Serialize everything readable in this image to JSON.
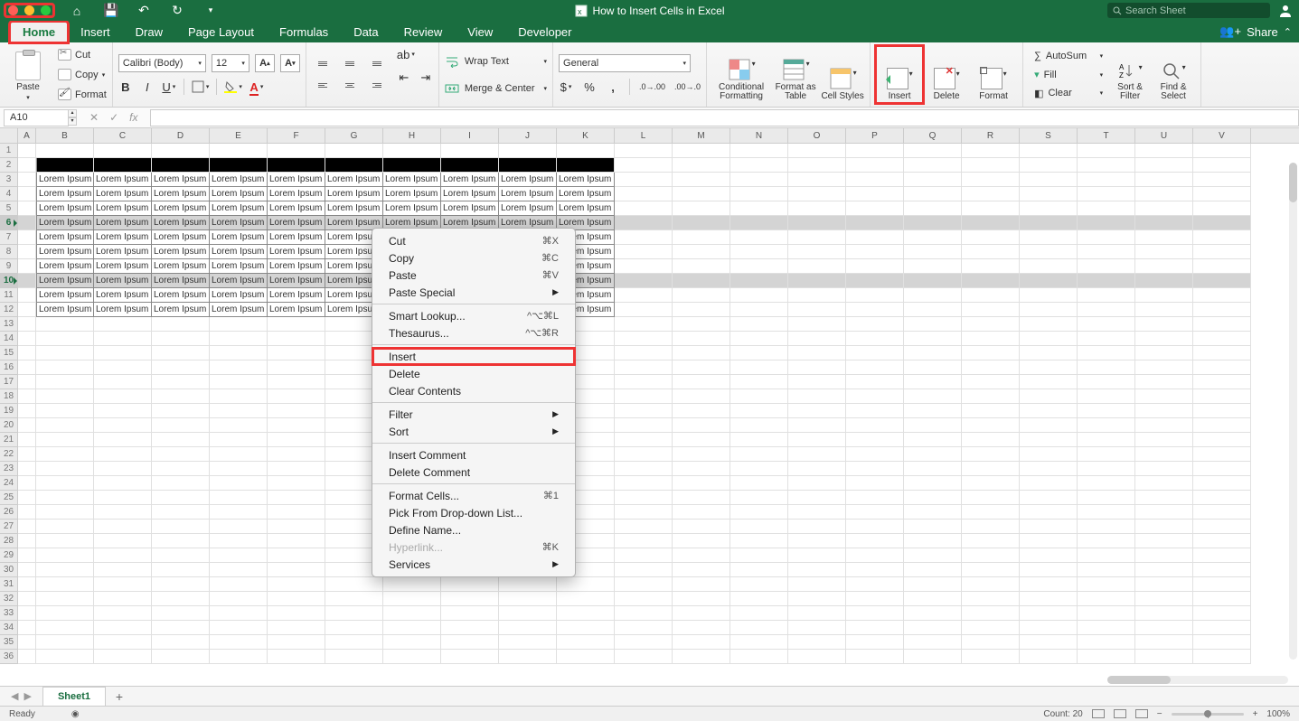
{
  "title": "How to Insert Cells in Excel",
  "search_placeholder": "Search Sheet",
  "share_label": "Share",
  "menu_tabs": [
    "Home",
    "Insert",
    "Draw",
    "Page Layout",
    "Formulas",
    "Data",
    "Review",
    "View",
    "Developer"
  ],
  "clipboard": {
    "paste": "Paste",
    "cut": "Cut",
    "copy": "Copy",
    "format": "Format"
  },
  "font": {
    "name": "Calibri (Body)",
    "size": "12"
  },
  "alignment": {
    "wrap": "Wrap Text",
    "merge": "Merge & Center"
  },
  "number": {
    "format": "General"
  },
  "cond": "Conditional Formatting",
  "fat": "Format as Table",
  "cellstyles": "Cell Styles",
  "cells": {
    "insert": "Insert",
    "delete": "Delete",
    "format": "Format"
  },
  "editing": {
    "autosum": "AutoSum",
    "fill": "Fill",
    "clear": "Clear"
  },
  "sortfilter": "Sort & Filter",
  "findselect": "Find & Select",
  "namebox": "A10",
  "columns": [
    "A",
    "B",
    "C",
    "D",
    "E",
    "F",
    "G",
    "H",
    "I",
    "J",
    "K",
    "L",
    "M",
    "N",
    "O",
    "P",
    "Q",
    "R",
    "S",
    "T",
    "U",
    "V"
  ],
  "cell_text": "Lorem Ipsum",
  "rows_visible": 36,
  "data_start_row": 3,
  "data_end_row": 12,
  "data_cols": 10,
  "black_row": 2,
  "selected_rows": [
    6,
    10
  ],
  "sheet": "Sheet1",
  "status": {
    "ready": "Ready",
    "count_label": "Count:",
    "count": "20",
    "zoom": "100%"
  },
  "ctx_menu": [
    {
      "label": "Cut",
      "sc": "⌘X"
    },
    {
      "label": "Copy",
      "sc": "⌘C"
    },
    {
      "label": "Paste",
      "sc": "⌘V"
    },
    {
      "label": "Paste Special",
      "arrow": true
    },
    {
      "sep": true
    },
    {
      "label": "Smart Lookup...",
      "sc": "^⌥⌘L"
    },
    {
      "label": "Thesaurus...",
      "sc": "^⌥⌘R"
    },
    {
      "sep": true
    },
    {
      "label": "Insert",
      "highlight": true
    },
    {
      "label": "Delete"
    },
    {
      "label": "Clear Contents"
    },
    {
      "sep": true
    },
    {
      "label": "Filter",
      "arrow": true
    },
    {
      "label": "Sort",
      "arrow": true
    },
    {
      "sep": true
    },
    {
      "label": "Insert Comment"
    },
    {
      "label": "Delete Comment"
    },
    {
      "sep": true
    },
    {
      "label": "Format Cells...",
      "sc": "⌘1"
    },
    {
      "label": "Pick From Drop-down List..."
    },
    {
      "label": "Define Name..."
    },
    {
      "label": "Hyperlink...",
      "sc": "⌘K",
      "disabled": true
    },
    {
      "label": "Services",
      "arrow": true
    }
  ],
  "highlight": {
    "home_tab": true,
    "insert_ribbon": true
  }
}
